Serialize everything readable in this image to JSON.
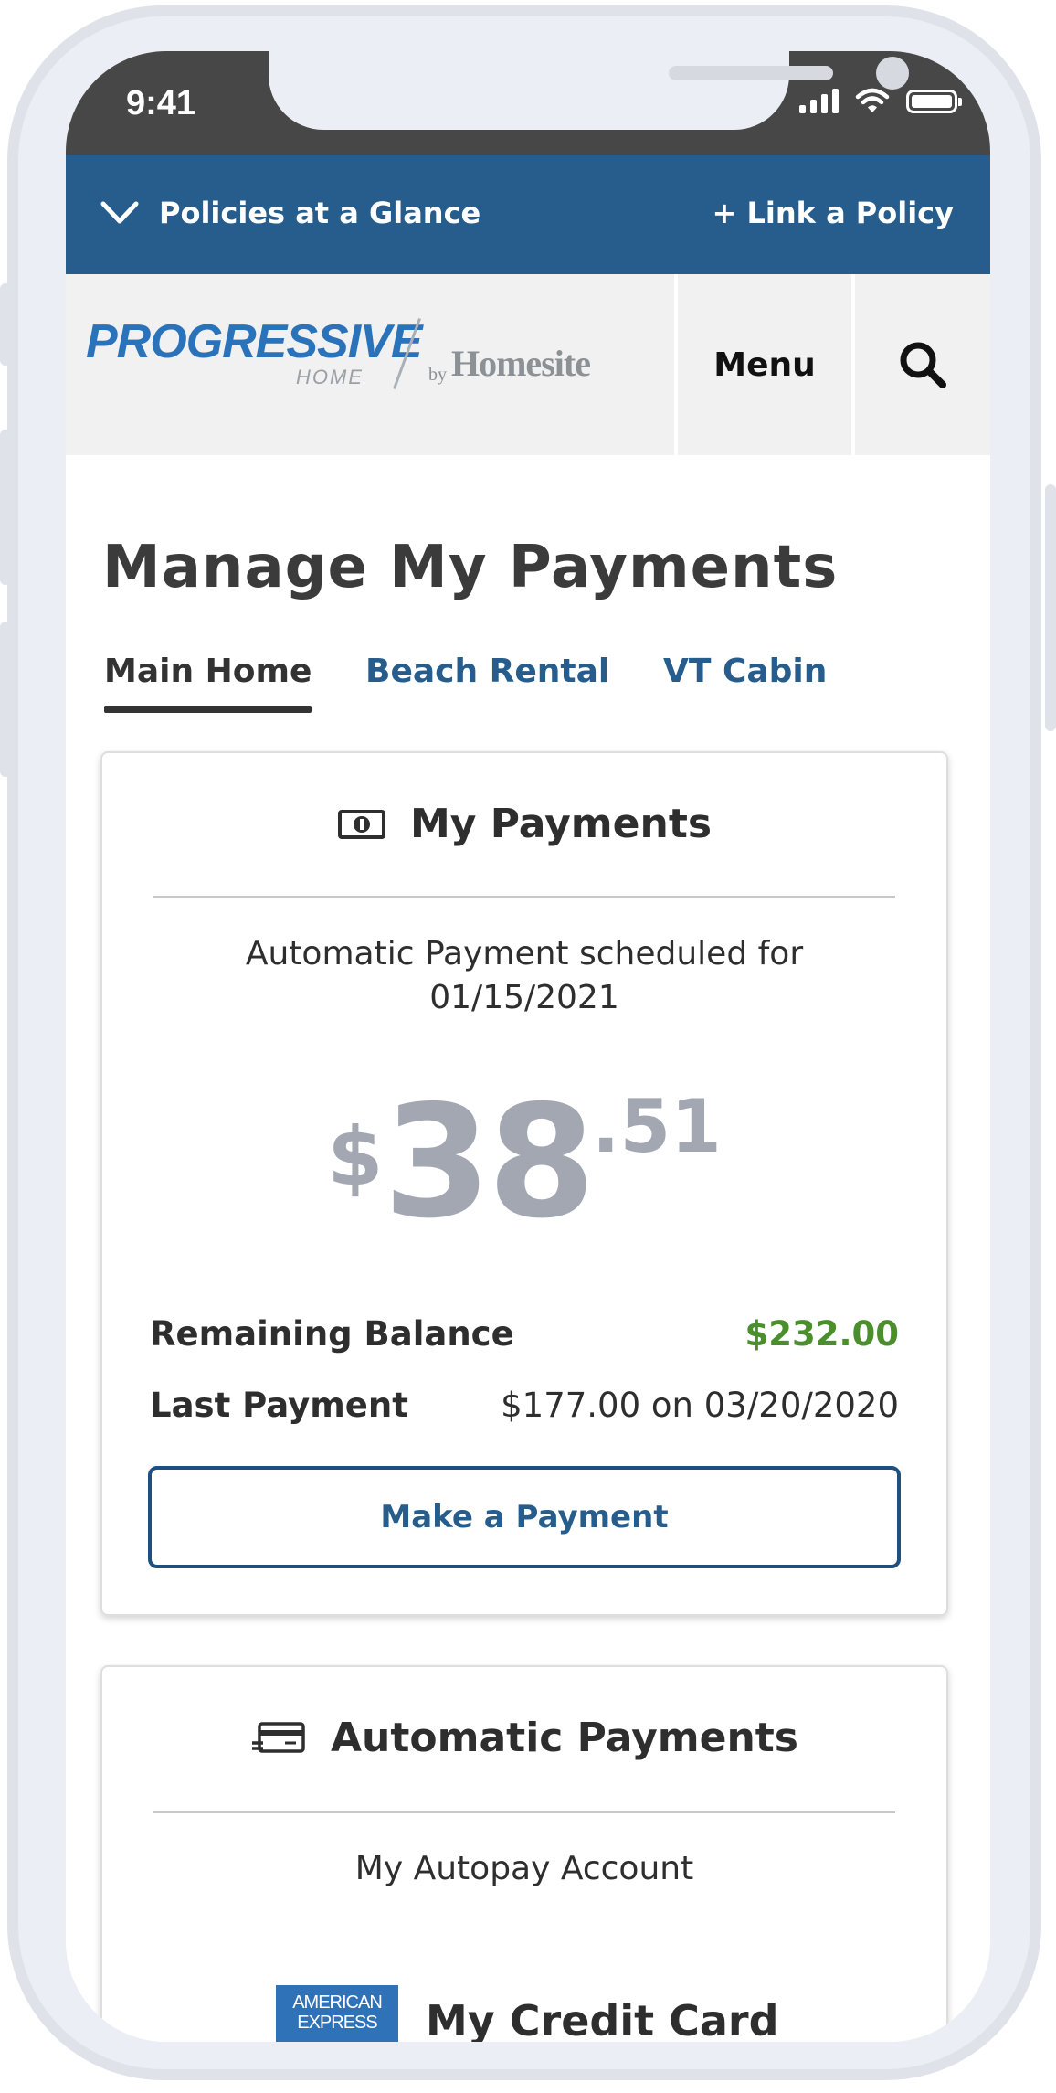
{
  "status_bar": {
    "time": "9:41"
  },
  "top_bar": {
    "policies_label": "Policies at a Glance",
    "link_label": "+ Link a Policy"
  },
  "header": {
    "logo": {
      "progressive": "PROGRESSIVE",
      "home": "HOME",
      "by": "by",
      "homesite": "Homesite"
    },
    "menu_label": "Menu"
  },
  "page": {
    "title": "Manage My Payments",
    "tabs": [
      {
        "label": "Main Home",
        "active": true
      },
      {
        "label": "Beach Rental",
        "active": false
      },
      {
        "label": "VT Cabin",
        "active": false
      }
    ]
  },
  "payments_card": {
    "title": "My Payments",
    "scheduled_line1": "Automatic Payment scheduled for",
    "scheduled_line2": "01/15/2021",
    "amount": {
      "currency": "$",
      "dollars": "38",
      "cents": ".51"
    },
    "remaining_label": "Remaining Balance",
    "remaining_value": "$232.00",
    "last_label": "Last Payment",
    "last_value": "$177.00 on 03/20/2020",
    "button_label": "Make a Payment"
  },
  "autopay_card": {
    "title": "Automatic Payments",
    "subtitle": "My Autopay Account",
    "card_brand": "AMERICAN EXPRESS",
    "card_label": "My Credit Card"
  },
  "colors": {
    "brand_blue": "#265d8c",
    "balance_green": "#4a8f2c",
    "amount_gray": "#a3a7b2"
  }
}
